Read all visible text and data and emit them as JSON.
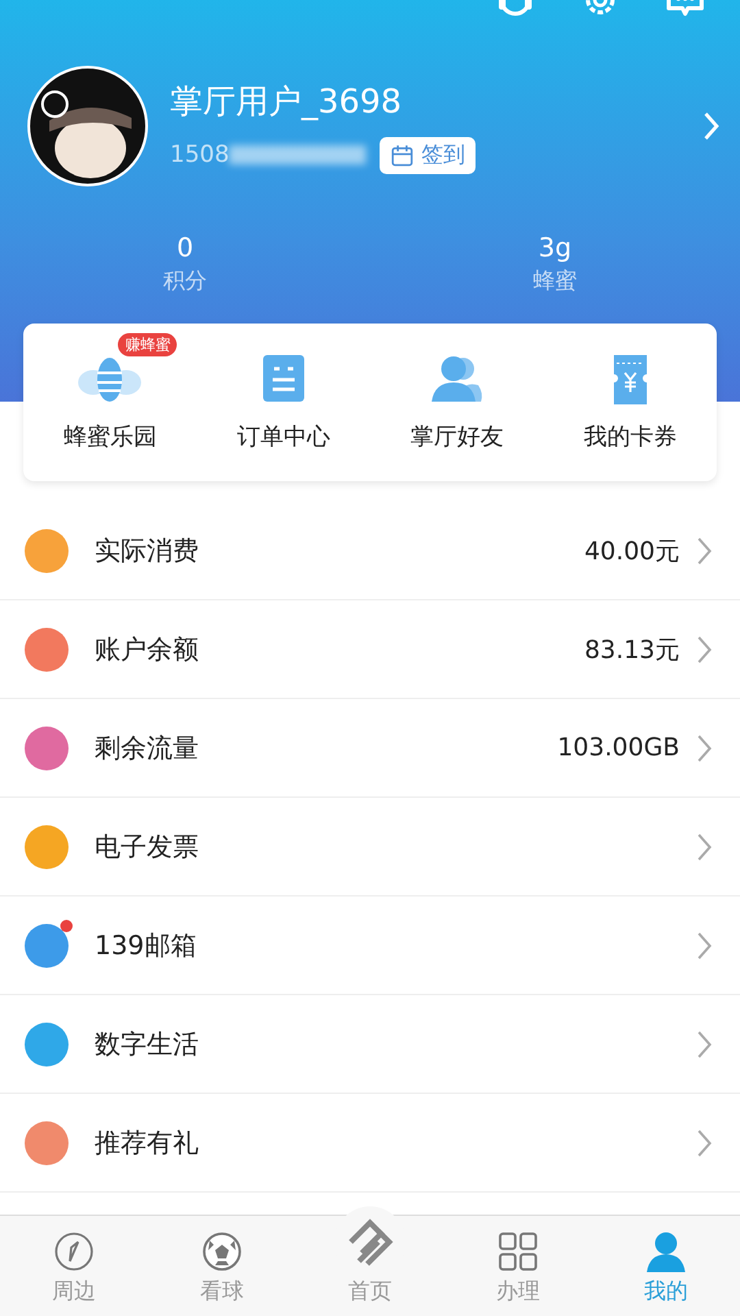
{
  "header": {
    "username": "掌厅用户_3698",
    "phone": "1508",
    "checkin": "签到"
  },
  "stats": [
    {
      "value": "0",
      "label": "积分"
    },
    {
      "value": "3g",
      "label": "蜂蜜"
    }
  ],
  "shortcuts": [
    {
      "kind": "bee",
      "label": "蜂蜜乐园",
      "badge": "赚蜂蜜"
    },
    {
      "kind": "order",
      "label": "订单中心"
    },
    {
      "kind": "friends",
      "label": "掌厅好友"
    },
    {
      "kind": "coupon",
      "label": "我的卡券"
    }
  ],
  "menu": [
    {
      "kind": "spend",
      "label": "实际消费",
      "value": "40.00元",
      "dot": false
    },
    {
      "kind": "balance",
      "label": "账户余额",
      "value": "83.13元",
      "dot": false
    },
    {
      "kind": "data",
      "label": "剩余流量",
      "value": "103.00GB",
      "dot": false
    },
    {
      "kind": "invoice",
      "label": "电子发票",
      "dot": false
    },
    {
      "kind": "mail",
      "label": "139邮箱",
      "dot": true
    },
    {
      "kind": "digital",
      "label": "数字生活",
      "dot": false
    },
    {
      "kind": "gift",
      "label": "推荐有礼",
      "dot": false
    }
  ],
  "tabbar": [
    {
      "kind": "compass",
      "label": "周边",
      "selected": false
    },
    {
      "kind": "ball",
      "label": "看球",
      "selected": false
    },
    {
      "kind": "logo",
      "label": "首页",
      "selected": false
    },
    {
      "kind": "grid",
      "label": "办理",
      "selected": false
    },
    {
      "kind": "person",
      "label": "我的",
      "selected": true
    }
  ]
}
